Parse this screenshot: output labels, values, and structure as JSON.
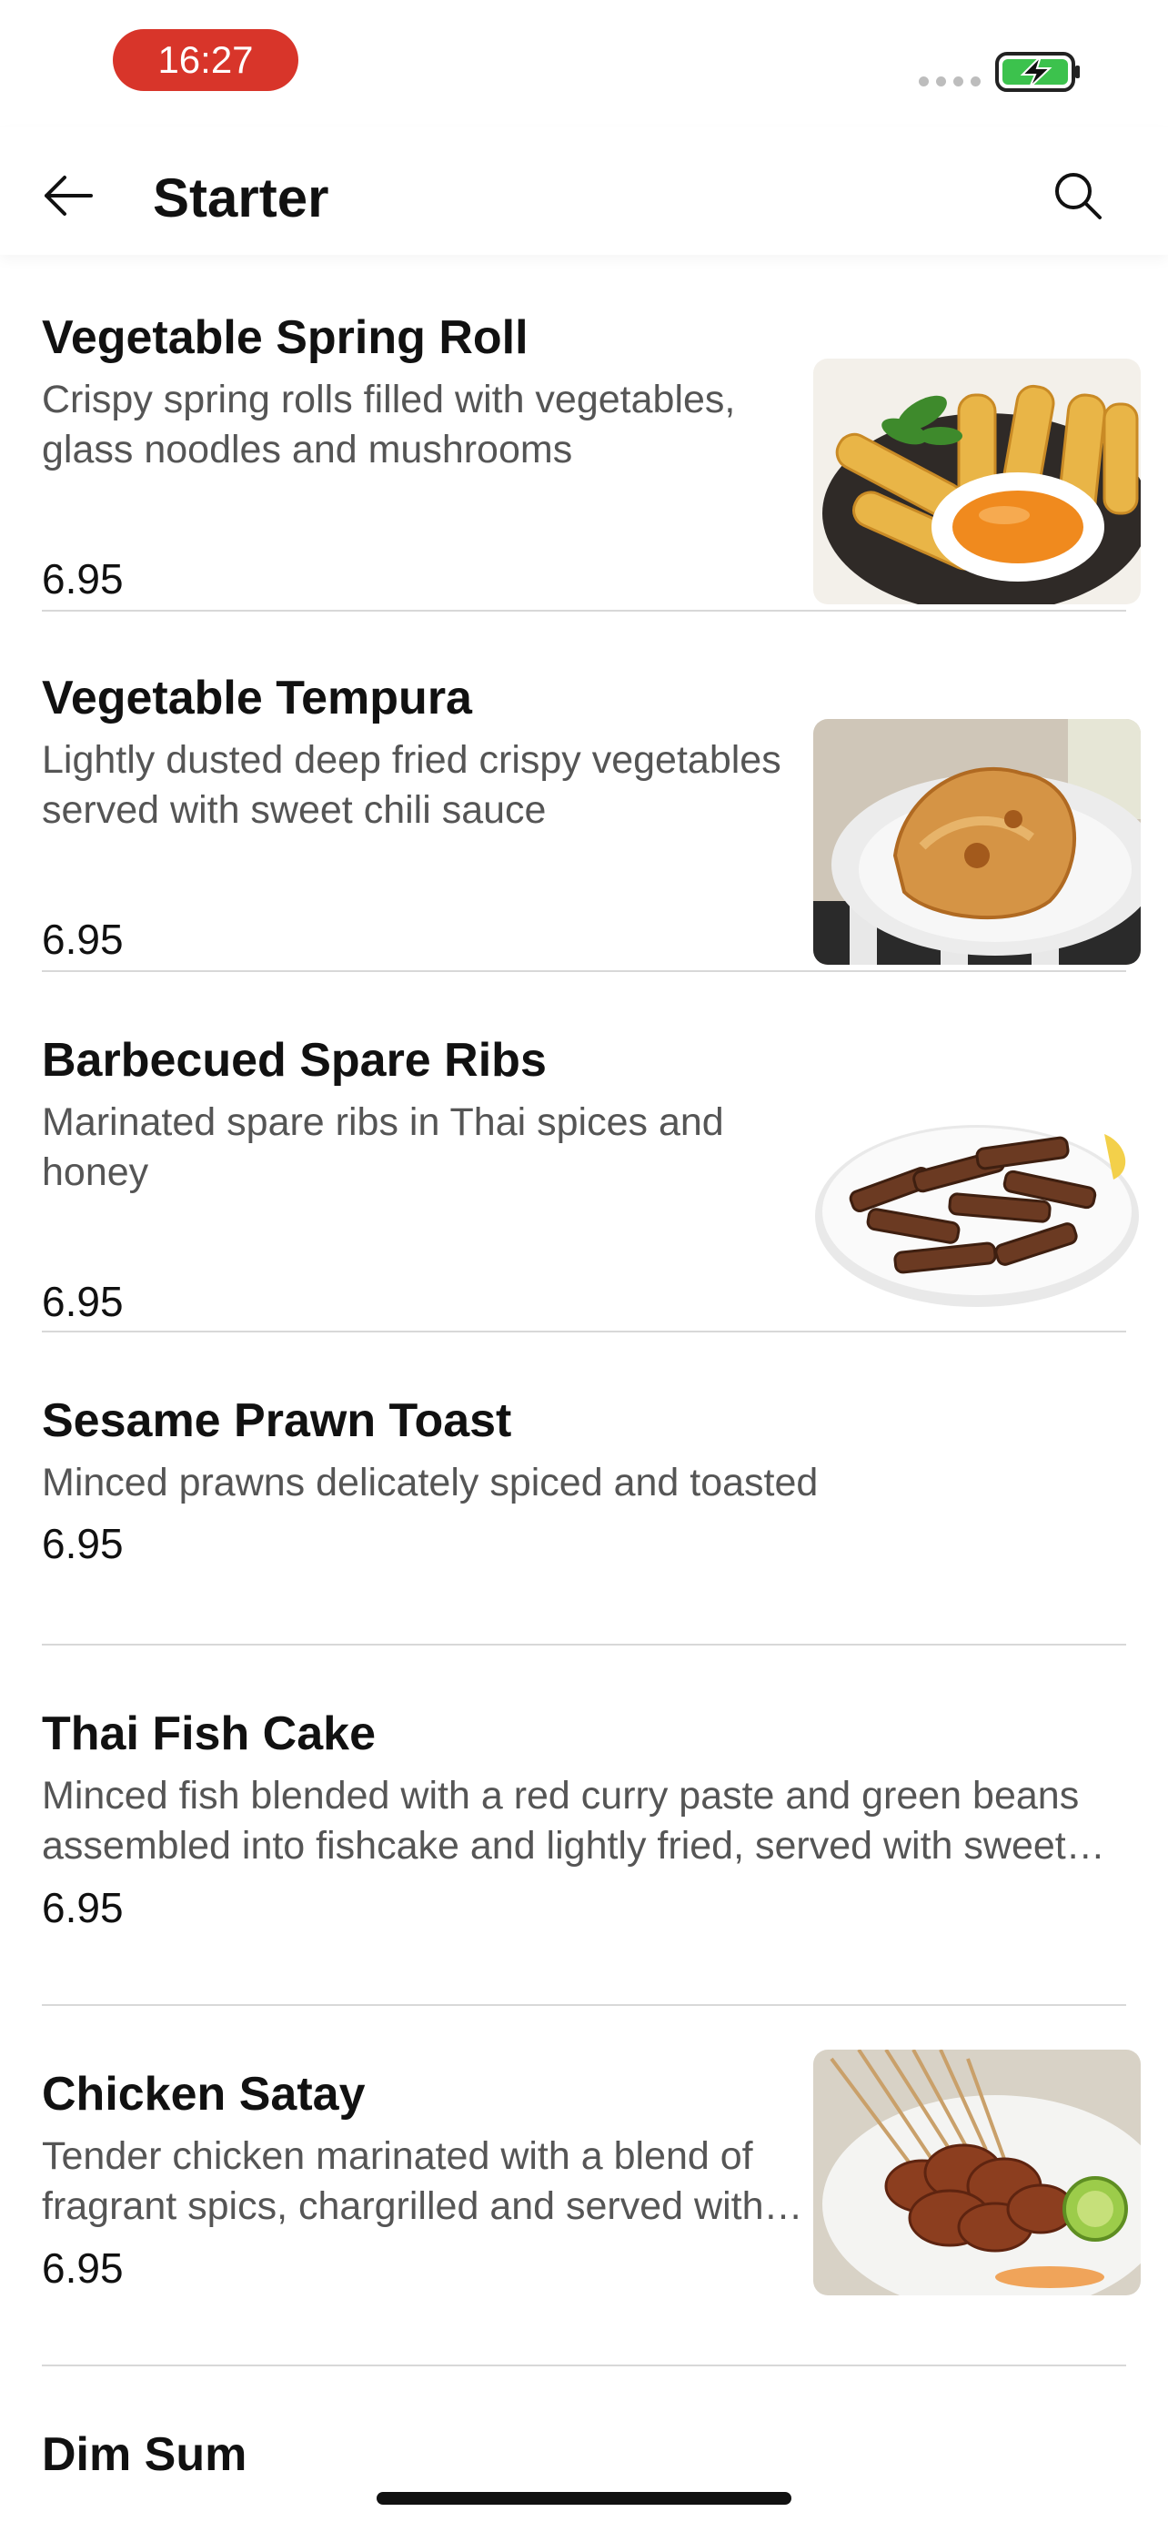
{
  "status_bar": {
    "time": "16:27",
    "battery_state": "charging",
    "colors": {
      "time_pill": "#d8352a",
      "battery_fill": "#3cc24d"
    }
  },
  "header": {
    "title": "Starter",
    "back_icon": "arrow-left-icon",
    "search_icon": "search-icon"
  },
  "items": [
    {
      "name": "Vegetable Spring Roll",
      "description": "Crispy spring rolls filled with vegetables, glass noodles and mushrooms",
      "price": "6.95",
      "image": "spring-roll-photo"
    },
    {
      "name": "Vegetable Tempura",
      "description": "Lightly dusted deep fried crispy vegetables served with sweet chili sauce",
      "price": "6.95",
      "image": "tempura-photo"
    },
    {
      "name": "Barbecued Spare Ribs",
      "description": "Marinated spare ribs in Thai spices and honey",
      "price": "6.95",
      "image": "spare-ribs-photo"
    },
    {
      "name": "Sesame Prawn Toast",
      "description": "Minced prawns delicately spiced and toasted",
      "price": "6.95"
    },
    {
      "name": "Thai Fish Cake",
      "description": "Minced fish blended with a red curry paste and green beans assembled into fishcake and lightly fried, served with sweet…",
      "price": "6.95"
    },
    {
      "name": "Chicken Satay",
      "description": "Tender chicken marinated with a blend of fragrant spics, chargrilled and served with…",
      "price": "6.95",
      "image": "chicken-satay-photo"
    },
    {
      "name": "Dim Sum"
    }
  ]
}
